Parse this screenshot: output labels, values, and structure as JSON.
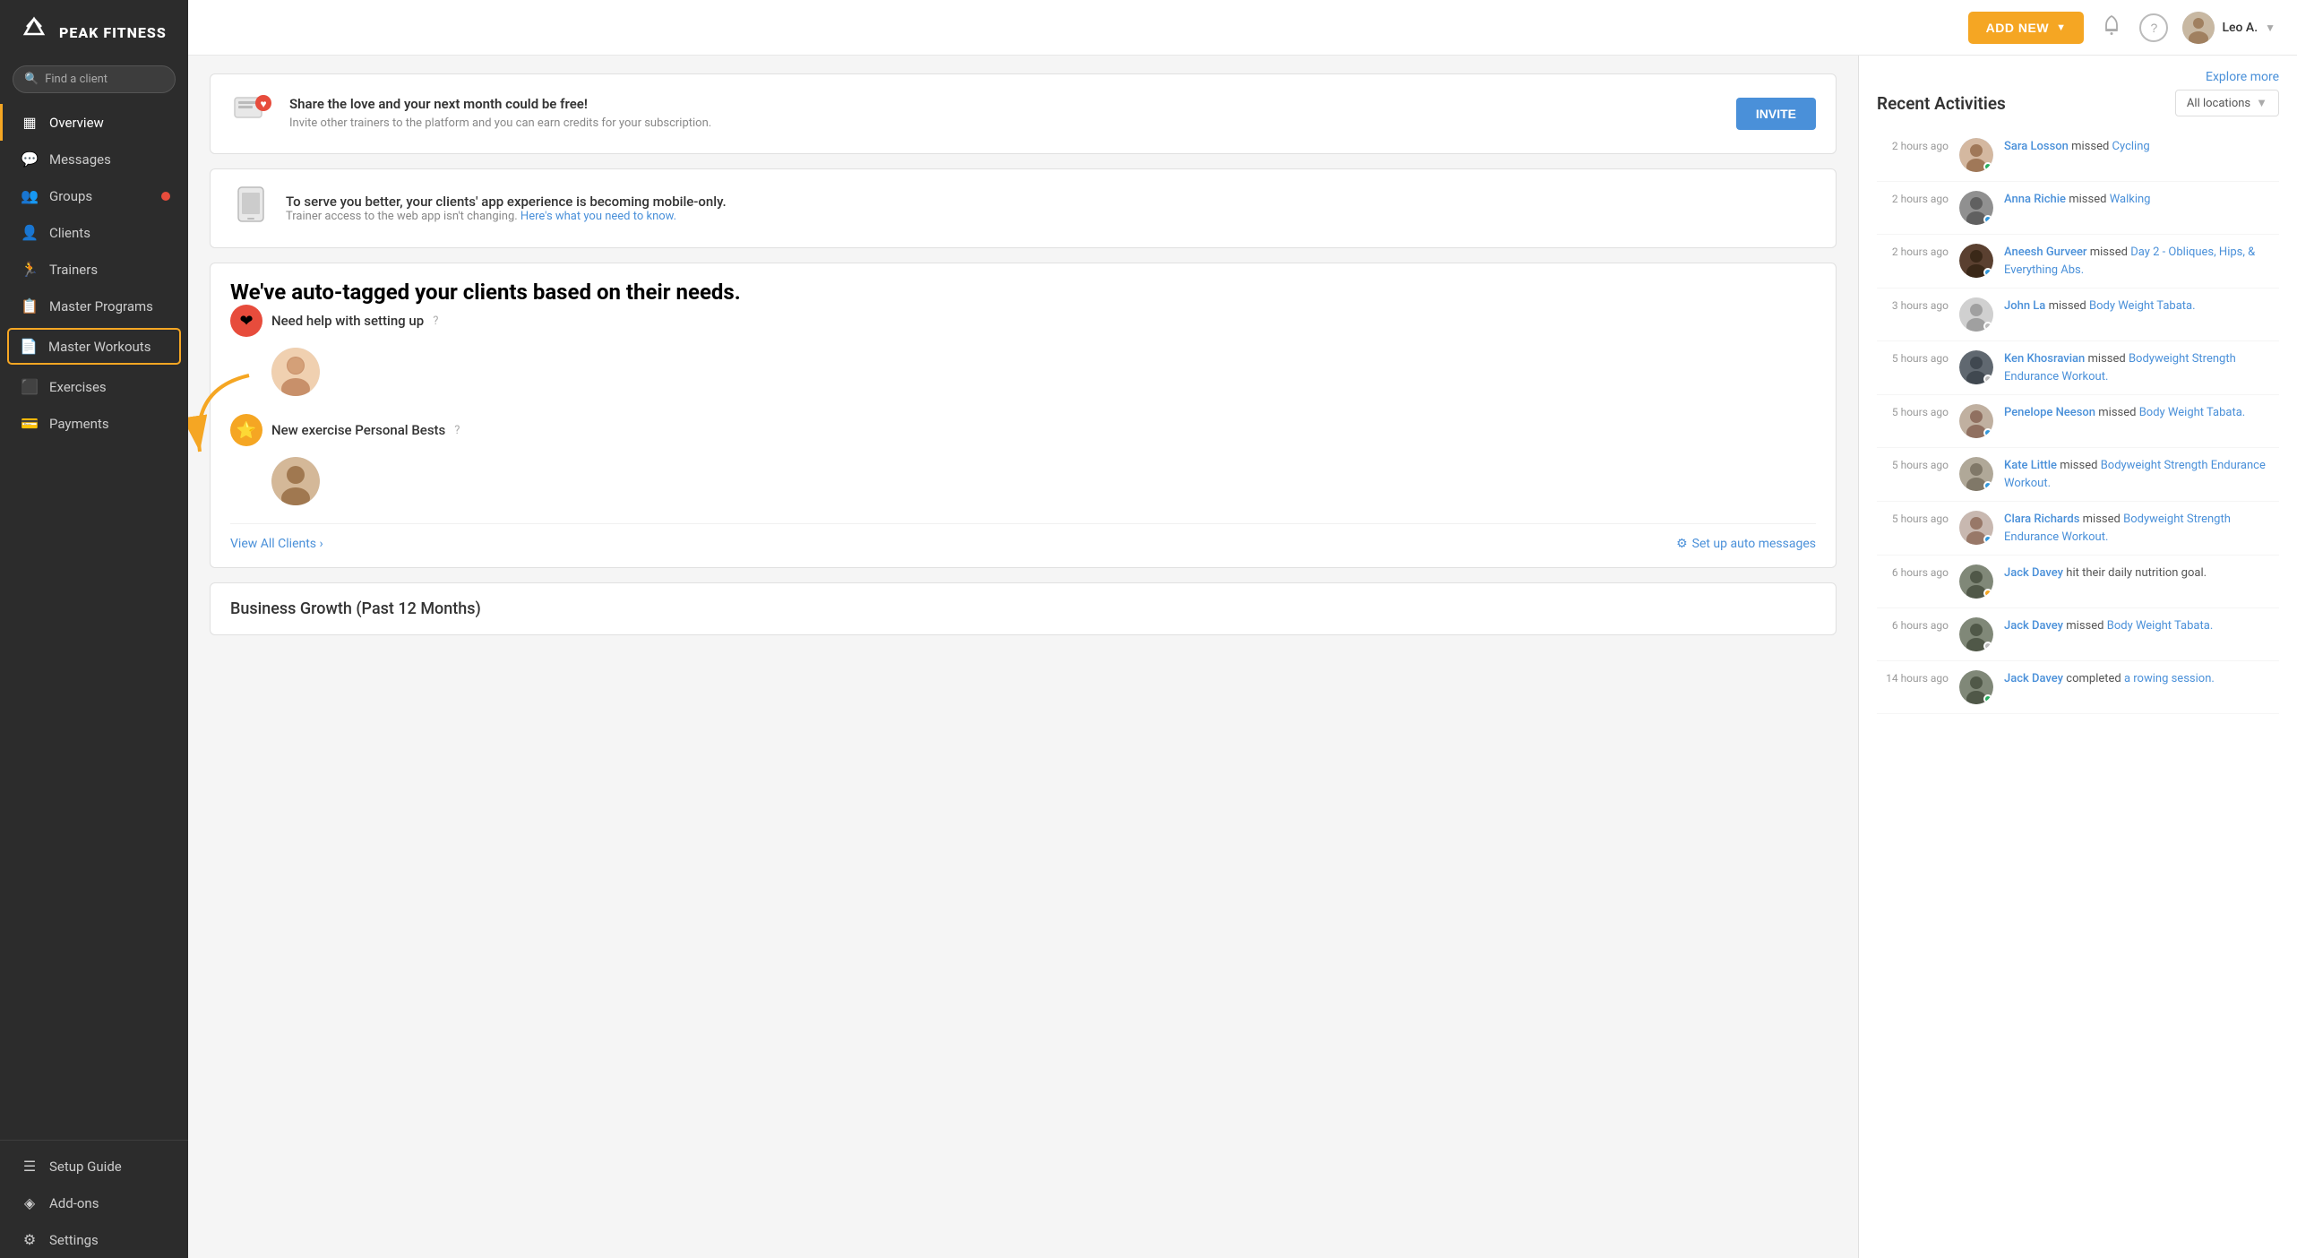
{
  "app": {
    "name": "PEAK FITNESS",
    "logo_symbol": "⛰"
  },
  "sidebar": {
    "search_placeholder": "Find a client",
    "nav_items": [
      {
        "id": "overview",
        "label": "Overview",
        "icon": "▦",
        "active": true
      },
      {
        "id": "messages",
        "label": "Messages",
        "icon": "💬",
        "badge": false
      },
      {
        "id": "groups",
        "label": "Groups",
        "icon": "👥",
        "badge": true
      },
      {
        "id": "clients",
        "label": "Clients",
        "icon": "👤",
        "badge": false
      },
      {
        "id": "trainers",
        "label": "Trainers",
        "icon": "🏃",
        "badge": false
      },
      {
        "id": "master-programs",
        "label": "Master Programs",
        "icon": "📋",
        "badge": false
      },
      {
        "id": "master-workouts",
        "label": "Master Workouts",
        "icon": "📄",
        "badge": false,
        "highlighted": true
      },
      {
        "id": "exercises",
        "label": "Exercises",
        "icon": "⬛",
        "badge": false
      },
      {
        "id": "payments",
        "label": "Payments",
        "icon": "💳",
        "badge": false
      }
    ],
    "bottom_items": [
      {
        "id": "setup-guide",
        "label": "Setup Guide",
        "icon": "☰"
      },
      {
        "id": "add-ons",
        "label": "Add-ons",
        "icon": "◈"
      },
      {
        "id": "settings",
        "label": "Settings",
        "icon": "⚙"
      }
    ]
  },
  "topbar": {
    "add_new_label": "ADD NEW",
    "user_name": "Leo A.",
    "notifications_icon": "bell",
    "help_icon": "question"
  },
  "promo_banner": {
    "title": "Share the love and your next month could be free!",
    "description": "Invite other trainers to the platform and you can earn credits for your subscription.",
    "button_label": "INVITE"
  },
  "mobile_banner": {
    "title": "To serve you better, your clients' app experience is becoming mobile-only.",
    "description": "Trainer access to the web app isn't changing.",
    "link_text": "Here's what you need to know."
  },
  "auto_tag": {
    "title": "We've auto-tagged your clients based on their needs.",
    "section1": {
      "label": "Need help with setting up",
      "icon": "❤",
      "color": "red"
    },
    "section2": {
      "label": "New exercise Personal Bests",
      "icon": "⭐",
      "color": "gold"
    },
    "view_all": "View All Clients",
    "setup_messages": "Set up auto messages"
  },
  "business_growth": {
    "title": "Business Growth (Past 12 Months)"
  },
  "right_panel": {
    "title": "Recent Activities",
    "explore_more": "Explore more",
    "location_filter": "All locations",
    "activities": [
      {
        "time": "2 hours ago",
        "name": "Sara Losson",
        "action": "missed",
        "item": "Cycling",
        "dot": "green"
      },
      {
        "time": "2 hours ago",
        "name": "Anna Richie",
        "action": "missed",
        "item": "Walking",
        "dot": "blue"
      },
      {
        "time": "2 hours ago",
        "name": "Aneesh Gurveer",
        "action": "missed",
        "item": "Day 2 - Obliques, Hips, & Everything Abs.",
        "dot": "blue"
      },
      {
        "time": "3 hours ago",
        "name": "John La",
        "action": "missed",
        "item": "Body Weight Tabata.",
        "dot": "gray"
      },
      {
        "time": "5 hours ago",
        "name": "Ken Khosravian",
        "action": "missed",
        "item": "Bodyweight Strength Endurance Workout.",
        "dot": "gray"
      },
      {
        "time": "5 hours ago",
        "name": "Penelope Neeson",
        "action": "missed",
        "item": "Body Weight Tabata.",
        "dot": "blue"
      },
      {
        "time": "5 hours ago",
        "name": "Kate Little",
        "action": "missed",
        "item": "Bodyweight Strength Endurance Workout.",
        "dot": "blue"
      },
      {
        "time": "5 hours ago",
        "name": "Clara Richards",
        "action": "missed",
        "item": "Bodyweight Strength Endurance Workout.",
        "dot": "blue"
      },
      {
        "time": "6 hours ago",
        "name": "Jack Davey",
        "action": "hit their daily nutrition goal.",
        "item": "",
        "dot": "orange"
      },
      {
        "time": "6 hours ago",
        "name": "Jack Davey",
        "action": "missed",
        "item": "Body Weight Tabata.",
        "dot": "gray"
      },
      {
        "time": "14 hours ago",
        "name": "Jack Davey",
        "action": "completed",
        "item": "a rowing session.",
        "dot": "green"
      }
    ]
  }
}
